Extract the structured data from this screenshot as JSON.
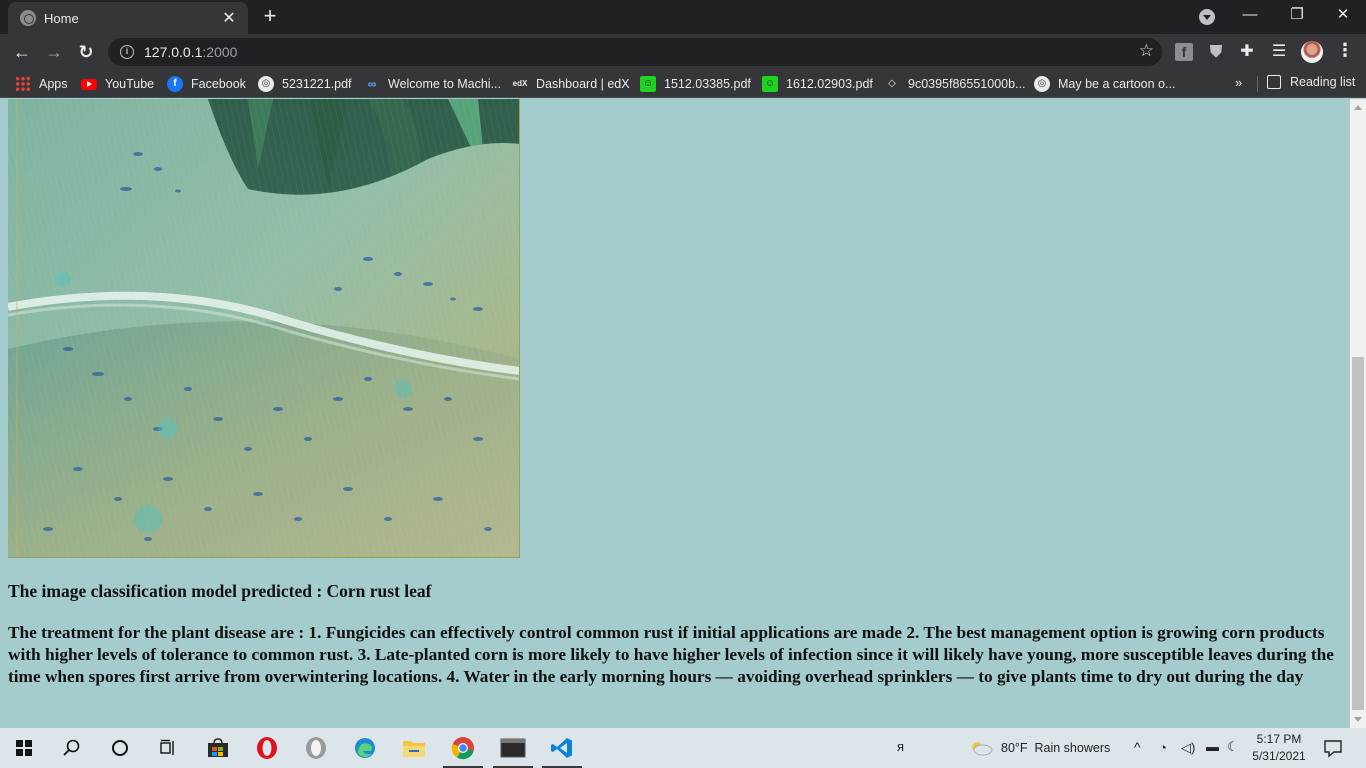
{
  "browser": {
    "tab": {
      "title": "Home",
      "close": "✕"
    },
    "new_tab": "+",
    "window_controls": {
      "minimize": "—",
      "restore": "❐",
      "close": "✕"
    },
    "toolbar": {
      "back": "←",
      "forward": "→",
      "reload": "↻",
      "url_host": "127.0.0.1",
      "url_port": ":2000",
      "star": "☆"
    },
    "bookmarks": [
      {
        "label": "Apps",
        "icon": "apps-grid-icon"
      },
      {
        "label": "YouTube",
        "icon": "youtube-icon"
      },
      {
        "label": "Facebook",
        "icon": "facebook-icon"
      },
      {
        "label": "5231221.pdf",
        "icon": "globe-icon"
      },
      {
        "label": "Welcome to Machi...",
        "icon": "coursera-icon"
      },
      {
        "label": "Dashboard | edX",
        "icon": "edx-icon"
      },
      {
        "label": "1512.03385.pdf",
        "icon": "smiley-icon"
      },
      {
        "label": "1612.02903.pdf",
        "icon": "smiley-icon"
      },
      {
        "label": "9c0395f86551000b...",
        "icon": "tag-icon"
      },
      {
        "label": "May be a cartoon o...",
        "icon": "globe-icon"
      }
    ],
    "bookmarks_more": "»",
    "reading_list": "Reading list"
  },
  "page": {
    "prediction": "The image classification model predicted : Corn rust leaf",
    "treatment": "The treatment for the plant disease are : 1. Fungicides can effectively control common rust if initial applications are made 2. The best management option is growing corn products with higher levels of tolerance to common rust. 3. Late-planted corn is more likely to have higher levels of infection since it will likely have young, more susceptible leaves during the time when spores first arrive from overwintering locations. 4. Water in the early morning hours — avoiding overhead sprinklers — to give plants time to dry out during the day"
  },
  "taskbar": {
    "weather": {
      "temp": "80°F",
      "condition": "Rain showers"
    },
    "time": "5:17 PM",
    "date": "5/31/2021"
  }
}
